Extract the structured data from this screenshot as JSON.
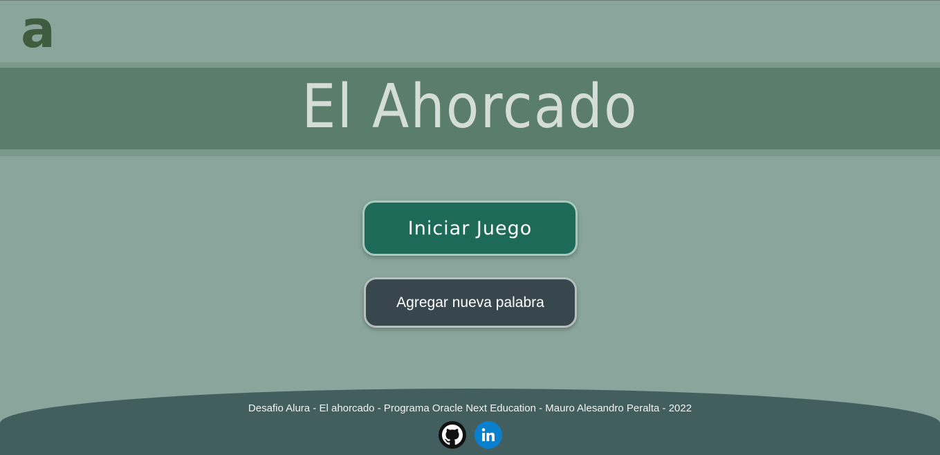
{
  "logo": {
    "letter": "a",
    "icon": "alura-logo-icon"
  },
  "header": {
    "title": "El Ahorcado"
  },
  "buttons": {
    "start_label": "Iniciar Juego",
    "add_word_label": "Agregar nueva palabra"
  },
  "footer": {
    "credits": "Desafio Alura - El ahorcado - Programa Oracle Next Education - Mauro Alesandro Peralta - 2022",
    "social": [
      {
        "icon": "github-icon",
        "color": "#111111"
      },
      {
        "icon": "linkedin-icon",
        "color": "#0a7fcd"
      }
    ]
  },
  "colors": {
    "background": "#8aa69c",
    "banner": "#5b7e6c",
    "start_button": "#1d6a58",
    "add_button": "#38474e",
    "footer": "#435e5e"
  }
}
